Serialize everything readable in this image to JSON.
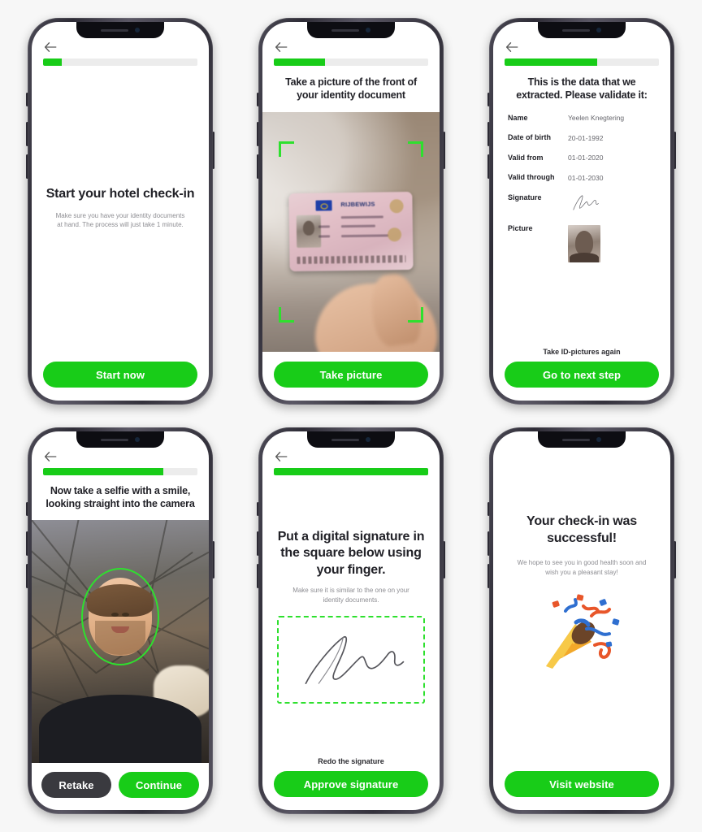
{
  "app": {
    "flow_name": "Hotel check-in",
    "accent_color": "#18cc18",
    "dark_button_color": "#3a3a3f",
    "frame_color": "#3b3944",
    "text_color": "#222228",
    "muted_text_color": "#8d8d92"
  },
  "screens": [
    {
      "id": "start",
      "back_icon": "arrow-left-icon",
      "progress_percent": 12,
      "title": "Start your hotel check-in",
      "body": "Make sure you have your identity documents at hand. The process will just take 1 minute.",
      "primary_button": "Start now"
    },
    {
      "id": "document-capture",
      "back_icon": "arrow-left-icon",
      "progress_percent": 33,
      "title": "Take a picture of the front of your identity document",
      "camera_overlay": "document-frame-corners",
      "document_label": "RIJBEWIJS",
      "primary_button": "Take picture"
    },
    {
      "id": "validate-data",
      "back_icon": "arrow-left-icon",
      "progress_percent": 60,
      "title": "This is the data that we extracted. Please validate it:",
      "fields": [
        {
          "label": "Name",
          "value": "Yeelen Knegtering",
          "type": "text"
        },
        {
          "label": "Date of birth",
          "value": "20-01-1992",
          "type": "text"
        },
        {
          "label": "Valid from",
          "value": "01-01-2020",
          "type": "text"
        },
        {
          "label": "Valid through",
          "value": "01-01-2030",
          "type": "text"
        },
        {
          "label": "Signature",
          "value": "",
          "type": "signature-image"
        },
        {
          "label": "Picture",
          "value": "",
          "type": "portrait-image"
        }
      ],
      "secondary_link": "Take ID-pictures again",
      "primary_button": "Go to next step"
    },
    {
      "id": "selfie",
      "back_icon": "arrow-left-icon",
      "progress_percent": 78,
      "title": "Now take a selfie with a smile, looking straight into the camera",
      "face_overlay": "face-oval-detection",
      "secondary_button": "Retake",
      "primary_button": "Continue"
    },
    {
      "id": "signature",
      "back_icon": "arrow-left-icon",
      "progress_percent": 100,
      "title": "Put a digital signature in the square below using your finger.",
      "body": "Make sure it is similar to the one on your identity documents.",
      "signature_field_placeholder": "",
      "secondary_link": "Redo the signature",
      "primary_button": "Approve signature"
    },
    {
      "id": "success",
      "progress_percent": 0,
      "title": "Your check-in was successful!",
      "body": "We hope to see you in good health soon and wish you a pleasant stay!",
      "illustration": "party-popper-icon",
      "primary_button": "Visit website"
    }
  ]
}
